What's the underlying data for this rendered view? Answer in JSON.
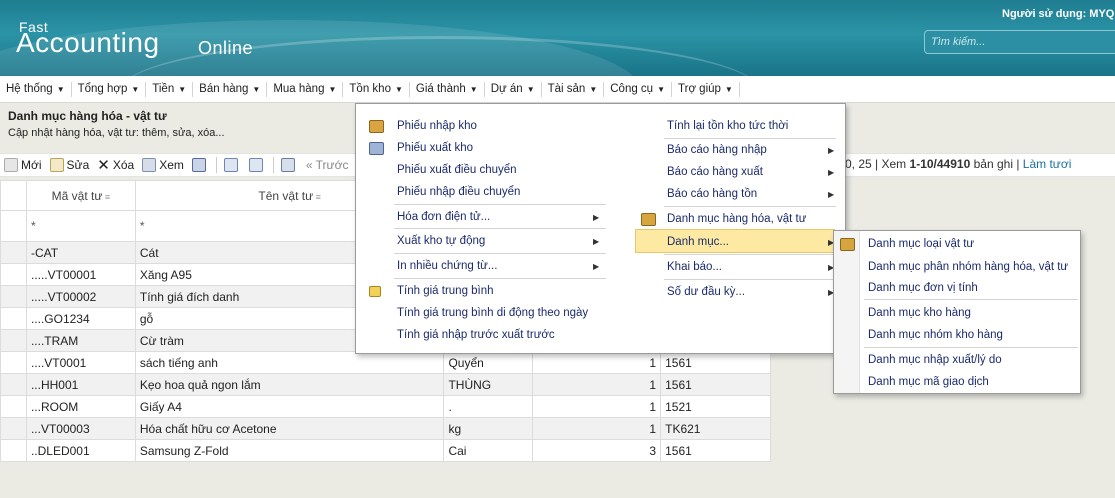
{
  "header": {
    "logo_small": "Fast",
    "logo_big": "Accounting",
    "logo_online": "Online",
    "user_label": "Người sử dụng: MYQUA",
    "search_placeholder": "Tìm kiếm..."
  },
  "menubar": [
    "Hệ thống",
    "Tổng hợp",
    "Tiền",
    "Bán hàng",
    "Mua hàng",
    "Tồn kho",
    "Giá thành",
    "Dự án",
    "Tài sản",
    "Công cụ",
    "Trợ giúp"
  ],
  "page": {
    "title": "Danh mục hàng hóa - vật tư",
    "subtitle": "Cập nhật hàng hóa, vật tư: thêm, sửa, xóa..."
  },
  "toolbar": {
    "new": "Mới",
    "edit": "Sửa",
    "delete": "Xóa",
    "view": "Xem",
    "prev": "« Trước",
    "pager_tail": "0, 25",
    "pager_view_prefix": "Xem",
    "pager_range": "1-10/44910",
    "pager_suffix": "bản ghi",
    "refresh": "Làm tươi"
  },
  "grid": {
    "col_code": "Mã vật tư",
    "col_name": "Tên vật tư",
    "filter_code": "*",
    "filter_name": "*",
    "rows": [
      {
        "code": "-CAT",
        "name": "Cát",
        "unit": "",
        "qty": "",
        "acct": ""
      },
      {
        "code": ".....VT00001",
        "name": "Xăng A95",
        "unit": "",
        "qty": "",
        "acct": ""
      },
      {
        "code": ".....VT00002",
        "name": "Tính giá đích danh",
        "unit": "",
        "qty": "",
        "acct": ""
      },
      {
        "code": "....GO1234",
        "name": "gỗ",
        "unit": "",
        "qty": "",
        "acct": ""
      },
      {
        "code": "....TRAM",
        "name": "Cừ tràm",
        "unit": "",
        "qty": "",
        "acct": ""
      },
      {
        "code": "....VT0001",
        "name": "sách tiếng anh",
        "unit": "Quyển",
        "qty": "1",
        "acct": "1561"
      },
      {
        "code": "...HH001",
        "name": " Kẹo hoa quả ngon lắm",
        "unit": "THÙNG",
        "qty": "1",
        "acct": "1561"
      },
      {
        "code": "...ROOM",
        "name": "Giấy A4",
        "unit": ".",
        "qty": "1",
        "acct": "1521"
      },
      {
        "code": "...VT00003",
        "name": "Hóa chất hữu cơ Acetone",
        "unit": "kg",
        "qty": "1",
        "acct": "TK621"
      },
      {
        "code": "..DLED001",
        "name": "Samsung Z-Fold",
        "unit": "Cai",
        "qty": "3",
        "acct": "1561"
      }
    ]
  },
  "dropdown": {
    "left": [
      "Phiếu nhập kho",
      "Phiếu xuất kho",
      "Phiếu xuất điều chuyển",
      "Phiếu nhập điều chuyển",
      "Hóa đơn điện tử...",
      "Xuất kho tự động",
      "In nhiều chứng từ...",
      "Tính giá trung bình",
      "Tính giá trung bình di động theo ngày",
      "Tính giá nhập trước xuất trước"
    ],
    "right": [
      "Tính lại tồn kho tức thời",
      "Báo cáo hàng nhập",
      "Báo cáo hàng xuất",
      "Báo cáo hàng tồn",
      "Danh mục hàng hóa, vật tư",
      "Danh mục...",
      "Khai báo...",
      "Số dư đầu kỳ..."
    ]
  },
  "submenu": [
    "Danh mục loại vật tư",
    "Danh mục phân nhóm hàng hóa, vật tư",
    "Danh mục đơn vị tính",
    "Danh mục kho hàng",
    "Danh mục nhóm kho hàng",
    "Danh mục nhập xuất/lý do",
    "Danh mục mã giao dịch"
  ]
}
